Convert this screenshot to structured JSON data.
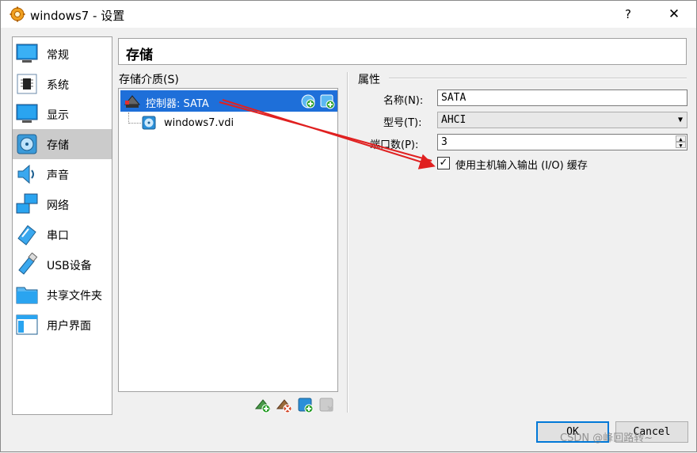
{
  "window": {
    "title": "windows7 - 设置",
    "help_label": "?",
    "close_label": "✕"
  },
  "sidebar": {
    "items": [
      {
        "label": "常规",
        "icon": "monitor-icon"
      },
      {
        "label": "系统",
        "icon": "chip-icon"
      },
      {
        "label": "显示",
        "icon": "display-icon"
      },
      {
        "label": "存储",
        "icon": "disk-icon",
        "selected": true
      },
      {
        "label": "声音",
        "icon": "speaker-icon"
      },
      {
        "label": "网络",
        "icon": "network-icon"
      },
      {
        "label": "串口",
        "icon": "serial-port-icon"
      },
      {
        "label": "USB设备",
        "icon": "usb-icon"
      },
      {
        "label": "共享文件夹",
        "icon": "folder-icon"
      },
      {
        "label": "用户界面",
        "icon": "ui-window-icon"
      }
    ]
  },
  "header": {
    "title": "存储"
  },
  "storage": {
    "label": "存储介质(S)",
    "controller_label": "控制器: SATA",
    "disk_label": "windows7.vdi"
  },
  "properties": {
    "label": "属性",
    "name_label": "名称(N):",
    "name_value": "SATA",
    "type_label": "型号(T):",
    "type_value": "AHCI",
    "port_label": "端口数(P):",
    "port_value": "3",
    "cache_label": "使用主机输入输出 (I/O) 缓存",
    "cache_checked": "✓"
  },
  "buttons": {
    "ok": "OK",
    "cancel": "Cancel"
  },
  "watermark": "CSDN @峰回路转~",
  "colors": {
    "selection": "#1e6fd9",
    "annotation_arrow": "#e02020"
  }
}
